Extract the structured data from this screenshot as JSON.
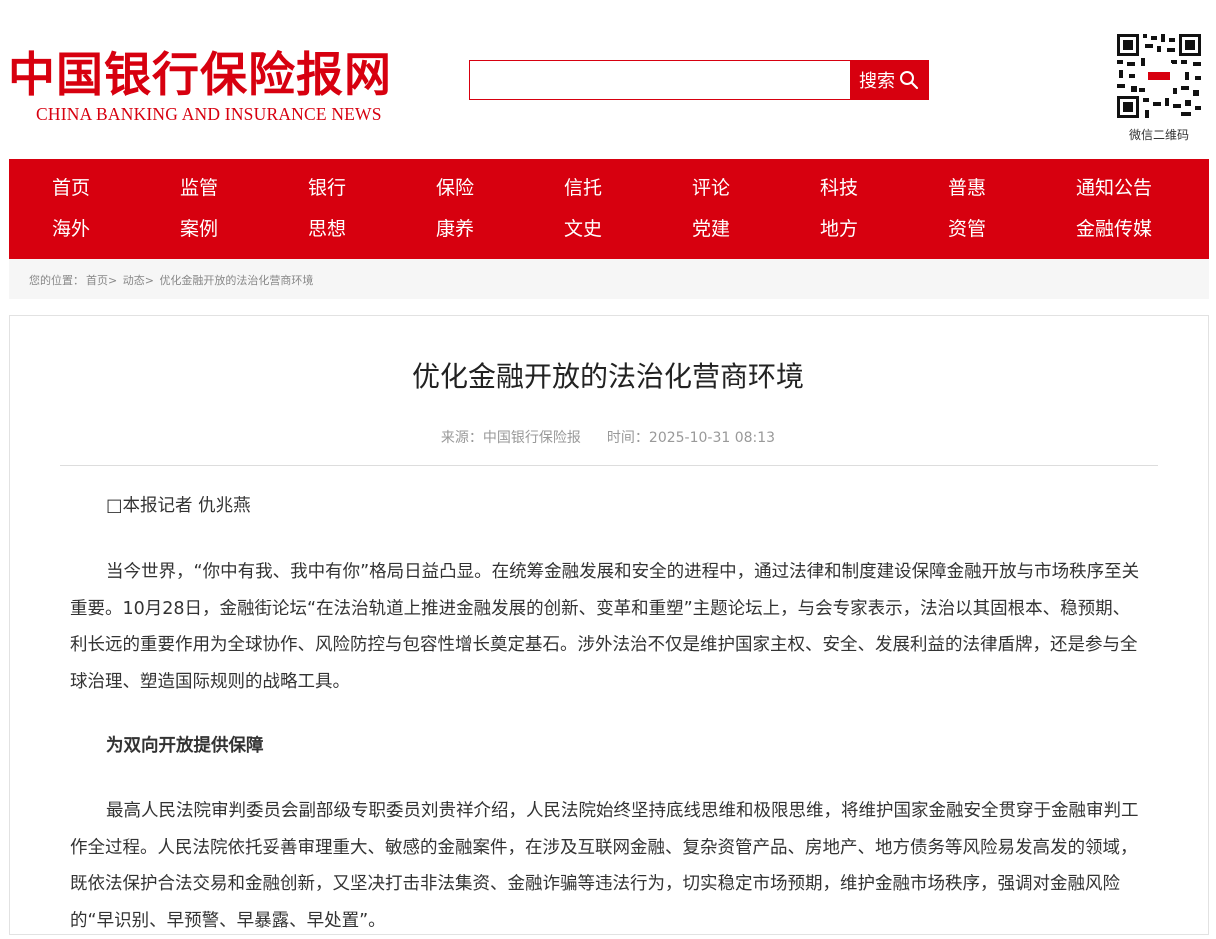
{
  "header": {
    "logo_cn": "中国银行保险报网",
    "logo_en": "CHINA BANKING AND INSURANCE NEWS",
    "search": {
      "placeholder": "",
      "button_label": "搜索"
    },
    "qr_caption": "微信二维码"
  },
  "nav": {
    "row1": [
      "首页",
      "监管",
      "银行",
      "保险",
      "信托",
      "评论",
      "科技",
      "普惠",
      "通知公告"
    ],
    "row2": [
      "海外",
      "案例",
      "思想",
      "康养",
      "文史",
      "党建",
      "地方",
      "资管",
      "金融传媒"
    ]
  },
  "breadcrumb": {
    "prefix": "您的位置：",
    "items": [
      "首页>",
      "动态>",
      "优化金融开放的法治化营商环境"
    ]
  },
  "article": {
    "title": "优化金融开放的法治化营商环境",
    "source": "来源：中国银行保险报",
    "time": "时间：2025-10-31 08:13",
    "byline": "□本报记者 仇兆燕",
    "paragraph1": "当今世界，“你中有我、我中有你”格局日益凸显。在统筹金融发展和安全的进程中，通过法律和制度建设保障金融开放与市场秩序至关重要。10月28日，金融街论坛“在法治轨道上推进金融发展的创新、变革和重塑”主题论坛上，与会专家表示，法治以其固根本、稳预期、利长远的重要作用为全球协作、风险防控与包容性增长奠定基石。涉外法治不仅是维护国家主权、安全、发展利益的法律盾牌，还是参与全球治理、塑造国际规则的战略工具。",
    "heading1": "为双向开放提供保障",
    "paragraph2": "最高人民法院审判委员会副部级专职委员刘贵祥介绍，人民法院始终坚持底线思维和极限思维，将维护国家金融安全贯穿于金融审判工作全过程。人民法院依托妥善审理重大、敏感的金融案件，在涉及互联网金融、复杂资管产品、房地产、地方债务等风险易发高发的领域，既依法保护合法交易和金融创新，又坚决打击非法集资、金融诈骗等违法行为，切实稳定市场预期，维护金融市场秩序，强调对金融风险的“早识别、早预警、早暴露、早处置”。"
  },
  "colors": {
    "brand_red": "#d7000f"
  }
}
